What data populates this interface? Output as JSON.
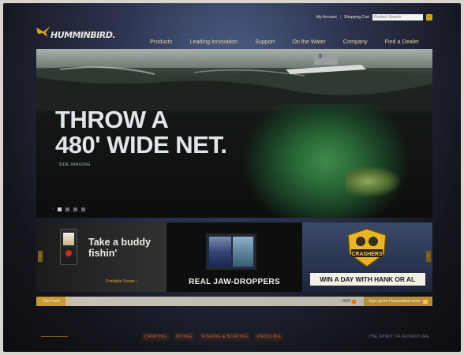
{
  "utility": {
    "my_account": "My Account",
    "shopping_cart": "Shopping Cart",
    "search_placeholder": "Product Search"
  },
  "logo": {
    "wordmark": "HUMMINBIRD."
  },
  "nav": [
    {
      "label": "Products"
    },
    {
      "label": "Leading Innovation"
    },
    {
      "label": "Support"
    },
    {
      "label": "On the Water"
    },
    {
      "label": "Company"
    },
    {
      "label": "Find a Dealer"
    }
  ],
  "hero": {
    "headline_line1": "THROW A",
    "headline_line2": "480' WIDE NET.",
    "tag": "SIDE IMAGING"
  },
  "promos": {
    "p1_headline": "Take a buddy fishin'",
    "p1_link": "Portable Sonar ›",
    "p2_label": "REAL JAW-DROPPERS",
    "p3_badge": "CRASHERS",
    "p3_label": "WIN A DAY WITH HANK OR AL"
  },
  "footbar": {
    "feed": "The Feed",
    "rss": "RSS",
    "signup": "Sign up for Humminbird news"
  },
  "bottom": {
    "categories": [
      "CAMPING",
      "DIVING",
      "FISHING & BOATING",
      "PADDLING"
    ],
    "spirit": "THE SPIRIT OF ADVENTURE"
  },
  "colors": {
    "accent_gold": "#d8a31e",
    "nav_text": "#e4d4a8",
    "category_text": "#d4603a"
  }
}
